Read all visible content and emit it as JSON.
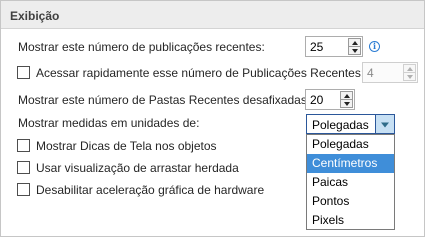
{
  "section": {
    "title": "Exibição"
  },
  "recent_publications": {
    "label": "Mostrar este número de publicações recentes:",
    "value": "25"
  },
  "quick_access": {
    "label": "Acessar rapidamente esse número de Publicações Recentes:",
    "checked": false,
    "value": "4"
  },
  "recent_folders": {
    "label": "Mostrar este número de Pastas Recentes desafixadas:",
    "value": "20"
  },
  "units": {
    "label": "Mostrar medidas em unidades de:",
    "selected": "Polegadas",
    "options": [
      "Polegadas",
      "Centímetros",
      "Paicas",
      "Pontos",
      "Pixels"
    ],
    "highlighted_option": "Centímetros"
  },
  "options": {
    "screen_tips": {
      "label": "Mostrar Dicas de Tela nos objetos",
      "checked": false
    },
    "legacy_drag": {
      "label": "Usar visualização de arrastar herdada",
      "checked": false
    },
    "disable_hw_accel": {
      "label": "Desabilitar aceleração gráfica de hardware",
      "checked": false
    }
  },
  "icons": {
    "info": "info-icon",
    "spin_up": "chevron-up-icon",
    "spin_down": "chevron-down-icon",
    "dropdown": "dropdown-arrow-icon"
  },
  "colors": {
    "accent": "#2b579a",
    "highlight": "#3f8ed9",
    "combo_button": "#c7e0f4",
    "header_bg": "#ededed"
  }
}
